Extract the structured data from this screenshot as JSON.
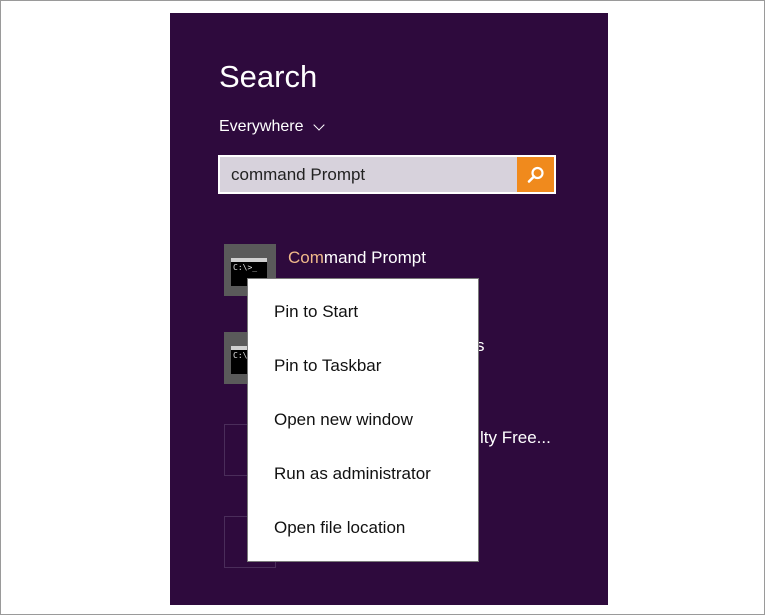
{
  "search": {
    "title": "Search",
    "scope_label": "Everywhere",
    "query": "command Prompt"
  },
  "results": [
    {
      "label_highlight": "Com",
      "label_rest": "mand Prompt",
      "icon": "command-prompt-icon"
    },
    {
      "label_partial": "s",
      "icon": "command-prompt-icon"
    },
    {
      "label_partial": "lty Free...",
      "icon": "app-tile-icon"
    },
    {
      "label_partial": "",
      "icon": "app-tile-icon"
    }
  ],
  "context_menu": {
    "items": [
      {
        "label": "Pin to Start"
      },
      {
        "label": "Pin to Taskbar"
      },
      {
        "label": "Open new window"
      },
      {
        "label": "Run as administrator"
      },
      {
        "label": "Open file location"
      }
    ]
  },
  "icons": {
    "cmd_glyph_text": "C:\\>_"
  },
  "colors": {
    "panel_bg": "#2e0a3d",
    "search_button": "#f08a1d",
    "highlight_text": "#f0b98a"
  }
}
